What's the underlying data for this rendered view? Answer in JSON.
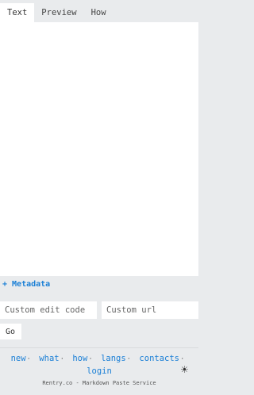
{
  "tabs": [
    {
      "label": "Text",
      "active": true
    },
    {
      "label": "Preview",
      "active": false
    },
    {
      "label": "How",
      "active": false
    }
  ],
  "editor": {
    "value": ""
  },
  "metadata": {
    "label": "+ Metadata"
  },
  "fields": {
    "edit_code_placeholder": "Custom edit code",
    "url_placeholder": "Custom url"
  },
  "go_button": {
    "label": "Go"
  },
  "footer": {
    "links": [
      {
        "label": "new"
      },
      {
        "label": "what"
      },
      {
        "label": "how"
      },
      {
        "label": "langs"
      },
      {
        "label": "contacts"
      },
      {
        "label": "login"
      }
    ],
    "separator": "·",
    "tagline": "Rentry.co - Markdown Paste Service",
    "theme_icon": "sun-icon",
    "theme_glyph": "☀"
  },
  "colors": {
    "accent": "#1a7fd6",
    "background": "#e9ebed",
    "panel": "#ffffff"
  }
}
